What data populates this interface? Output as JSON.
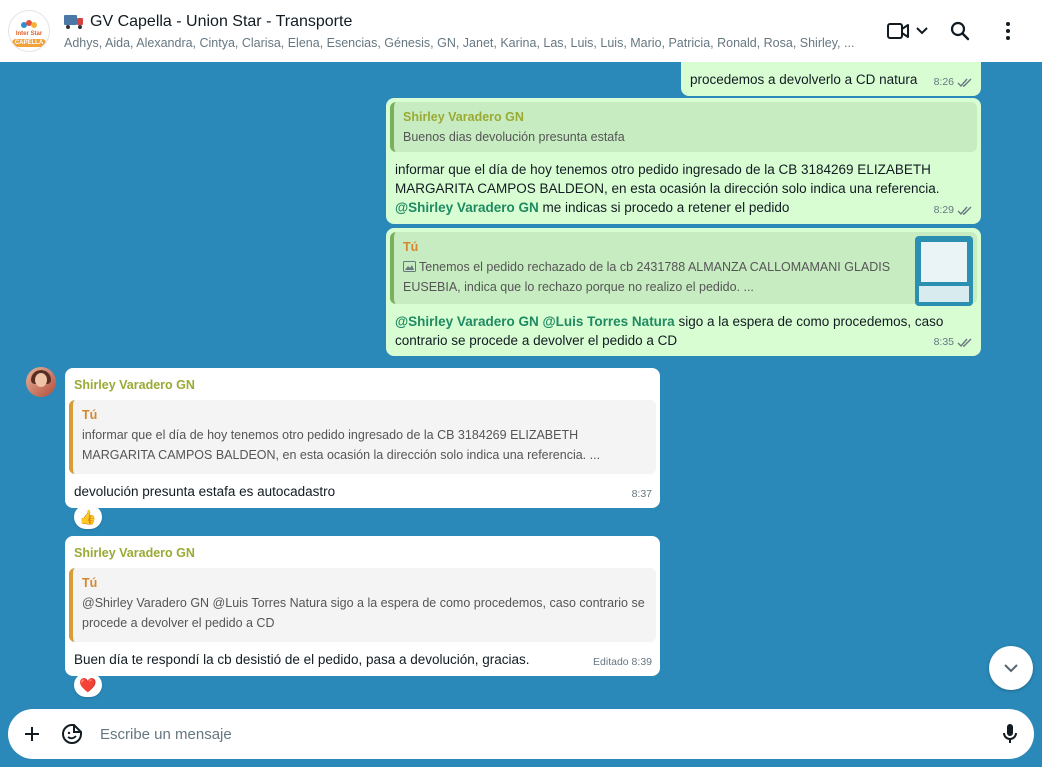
{
  "header": {
    "group_logo_text": "Inter Star",
    "group_logo_banner": "CAPELLA",
    "title": "GV Capella - Union Star - Transporte",
    "members": "Adhys, Aida, Alexandra, Cintya, Clarisa, Elena, Esencias, Génesis, GN, Janet, Karina, Las, Luis, Luis, Mario, Patricia, Ronald, Rosa, Shirley, ...",
    "icons": [
      "truck-icon",
      "video-call-icon",
      "chevron-down-icon",
      "search-icon",
      "menu-icon"
    ]
  },
  "messages": [
    {
      "direction": "out",
      "text": "procedemos a devolverlo a CD natura",
      "time": "8:26"
    },
    {
      "direction": "out",
      "quote": {
        "author": "Shirley Varadero GN",
        "text": "Buenos dias devolución presunta estafa"
      },
      "text": "informar que el día de hoy tenemos otro pedido ingresado de la CB 3184269 ELIZABETH MARGARITA CAMPOS BALDEON, en esta ocasión la dirección solo indica una referencia.",
      "mention": "@Shirley Varadero GN",
      "text_after": " me indicas si procedo a retener el pedido",
      "time": "8:29"
    },
    {
      "direction": "out",
      "quote": {
        "author": "Tú",
        "text": "Tenemos el pedido rechazado de la cb 2431788 ALMANZA CALLOMAMANI GLADIS EUSEBIA, indica que lo rechazo porque no realizo el pedido. ..."
      },
      "mention1": "@Shirley Varadero GN",
      "mention2": "@Luis Torres Natura",
      "text": " sigo a la espera de como procedemos, caso contrario se procede a devolver el pedido a CD",
      "time": "8:35"
    },
    {
      "direction": "in",
      "sender": "Shirley Varadero GN",
      "quote": {
        "author": "Tú",
        "text": "informar que el día de hoy tenemos otro pedido ingresado de la CB 3184269 ELIZABETH MARGARITA CAMPOS BALDEON, en esta ocasión la dirección solo indica una referencia. ..."
      },
      "text": "devolución presunta estafa es autocadastro",
      "time": "8:37",
      "reaction": "👍"
    },
    {
      "direction": "in",
      "sender": "Shirley Varadero GN",
      "quote": {
        "author": "Tú",
        "text": "@Shirley Varadero GN @Luis Torres Natura sigo a la espera de como procedemos, caso contrario se procede a devolver el pedido a CD"
      },
      "text": "Buen día te respondí la cb desistió de el pedido, pasa a devolución, gracias.",
      "time": "Editado 8:39",
      "reaction": "❤️"
    }
  ],
  "composer": {
    "placeholder": "Escribe un mensaje",
    "icons": [
      "plus-icon",
      "sticker-icon",
      "mic-icon"
    ]
  },
  "colors": {
    "chat_bg": "#2a89b8",
    "outgoing": "#d9fdd3",
    "incoming": "#ffffff",
    "mention": "#1f8a62",
    "sender": "#9aaa33"
  }
}
